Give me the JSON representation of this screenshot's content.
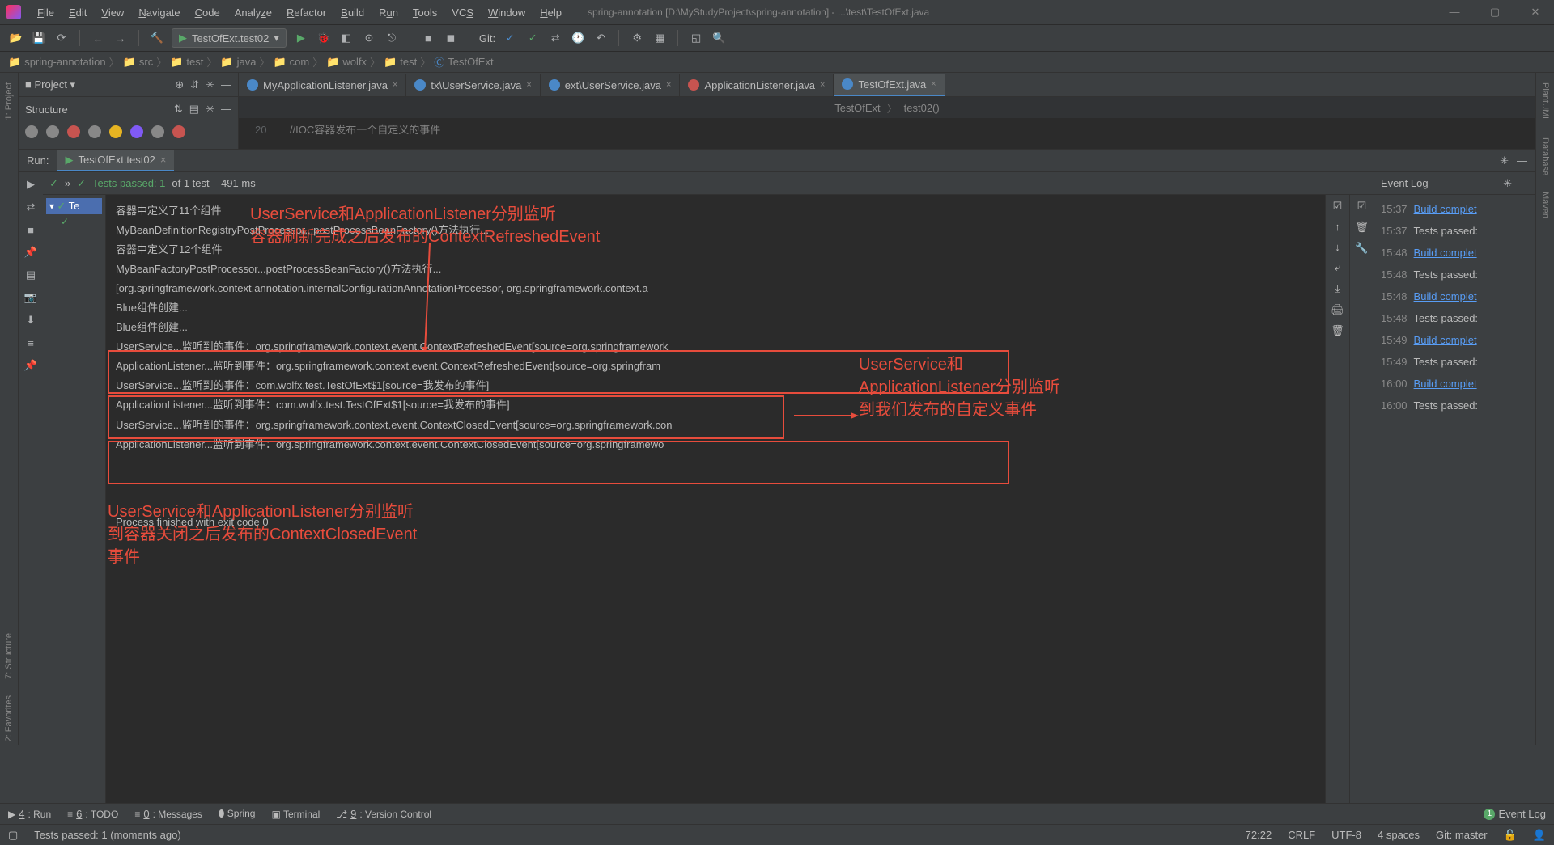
{
  "title": "spring-annotation [D:\\MyStudyProject\\spring-annotation] - ...\\test\\TestOfExt.java",
  "menu": [
    "File",
    "Edit",
    "View",
    "Navigate",
    "Code",
    "Analyze",
    "Refactor",
    "Build",
    "Run",
    "Tools",
    "VCS",
    "Window",
    "Help"
  ],
  "runConfig": "TestOfExt.test02",
  "git": "Git:",
  "breadcrumb": [
    "spring-annotation",
    "src",
    "test",
    "java",
    "com",
    "wolfx",
    "test",
    "TestOfExt"
  ],
  "projectPanel": {
    "title": "Project",
    "structure": "Structure"
  },
  "rightSideTabs": [
    "PlantUML",
    "Database",
    "Maven"
  ],
  "leftSideTabs": [
    "1: Project",
    "7: Structure",
    "2: Favorites"
  ],
  "editorTabs": [
    {
      "name": "MyApplicationListener.java",
      "color": "#4a88c7"
    },
    {
      "name": "tx\\UserService.java",
      "color": "#4a88c7"
    },
    {
      "name": "ext\\UserService.java",
      "color": "#4a88c7"
    },
    {
      "name": "ApplicationListener.java",
      "color": "#c75450"
    },
    {
      "name": "TestOfExt.java",
      "color": "#4a88c7",
      "active": true
    }
  ],
  "editorBc": [
    "TestOfExt",
    "test02()"
  ],
  "codeLineNo": "20",
  "codeComment": "//IOC容器发布一个自定义的事件",
  "run": {
    "label": "Run:",
    "tab": "TestOfExt.test02",
    "status": "Tests passed: 1",
    "statusSuffix": "of 1 test – 491 ms",
    "testTree": "Te"
  },
  "console": [
    "容器中定义了11个组件",
    "MyBeanDefinitionRegistryPostProcessor...postProcessBeanFactory()方法执行...",
    "容器中定义了12个组件",
    "MyBeanFactoryPostProcessor...postProcessBeanFactory()方法执行...",
    "[org.springframework.context.annotation.internalConfigurationAnnotationProcessor, org.springframework.context.a",
    "Blue组件创建...",
    "Blue组件创建...",
    "UserService...监听到的事件：org.springframework.context.event.ContextRefreshedEvent[source=org.springframework",
    "ApplicationListener...监听到事件：org.springframework.context.event.ContextRefreshedEvent[source=org.springfram",
    "UserService...监听到的事件：com.wolfx.test.TestOfExt$1[source=我发布的事件]",
    "ApplicationListener...监听到事件：com.wolfx.test.TestOfExt$1[source=我发布的事件]",
    "UserService...监听到的事件：org.springframework.context.event.ContextClosedEvent[source=org.springframework.con",
    "ApplicationListener...监听到事件：org.springframework.context.event.ContextClosedEvent[source=org.springframewo",
    "",
    "",
    "",
    "Process finished with exit code 0"
  ],
  "annotations": {
    "top": "UserService和ApplicationListener分别监听\n容器刷新完成之后发布的ContextRefreshedEvent",
    "right": "UserService和\nApplicationListener分别监听\n到我们发布的自定义事件",
    "bottom": "UserService和ApplicationListener分别监听\n到容器关闭之后发布的ContextClosedEvent\n事件"
  },
  "eventLog": {
    "title": "Event Log",
    "items": [
      {
        "time": "15:37",
        "text": "Build complet",
        "link": true
      },
      {
        "time": "15:37",
        "text": "Tests passed:",
        "link": false
      },
      {
        "time": "15:48",
        "text": "Build complet",
        "link": true
      },
      {
        "time": "15:48",
        "text": "Tests passed:",
        "link": false
      },
      {
        "time": "15:48",
        "text": "Build complet",
        "link": true
      },
      {
        "time": "15:48",
        "text": "Tests passed:",
        "link": false
      },
      {
        "time": "15:49",
        "text": "Build complet",
        "link": true
      },
      {
        "time": "15:49",
        "text": "Tests passed:",
        "link": false
      },
      {
        "time": "16:00",
        "text": "Build complet",
        "link": true
      },
      {
        "time": "16:00",
        "text": "Tests passed:",
        "link": false
      }
    ]
  },
  "bottomBar": [
    "4: Run",
    "6: TODO",
    "0: Messages",
    "Spring",
    "Terminal",
    "9: Version Control"
  ],
  "bottomBarRight": "Event Log",
  "statusBar": {
    "msg": "Tests passed: 1 (moments ago)",
    "right": [
      "72:22",
      "CRLF",
      "UTF-8",
      "4 spaces",
      "Git: master"
    ]
  }
}
